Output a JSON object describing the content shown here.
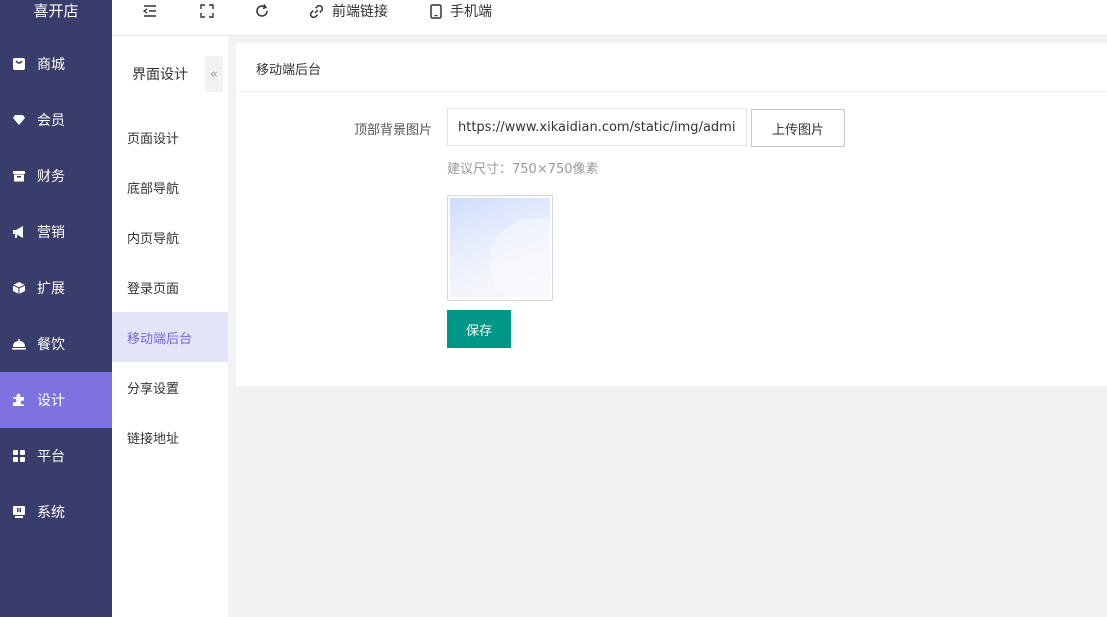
{
  "app": {
    "brand": "喜开店"
  },
  "sidebar": {
    "items": [
      {
        "label": "商城",
        "icon": "store-icon"
      },
      {
        "label": "会员",
        "icon": "diamond-icon"
      },
      {
        "label": "财务",
        "icon": "wallet-icon"
      },
      {
        "label": "营销",
        "icon": "megaphone-icon"
      },
      {
        "label": "扩展",
        "icon": "cube-icon"
      },
      {
        "label": "餐饮",
        "icon": "dish-icon"
      },
      {
        "label": "设计",
        "icon": "puzzle-icon",
        "active": true
      },
      {
        "label": "平台",
        "icon": "grid-icon"
      },
      {
        "label": "系统",
        "icon": "monitor-icon"
      }
    ],
    "active_color": "#7d72e0",
    "bg_color": "#393d6b"
  },
  "topbar": {
    "frontend_link": "前端链接",
    "mobile": "手机端"
  },
  "subnav": {
    "title": "界面设计",
    "collapse_glyph": "«",
    "items": [
      {
        "label": "页面设计"
      },
      {
        "label": "底部导航"
      },
      {
        "label": "内页导航"
      },
      {
        "label": "登录页面"
      },
      {
        "label": "移动端后台",
        "active": true
      },
      {
        "label": "分享设置"
      },
      {
        "label": "链接地址"
      }
    ]
  },
  "main": {
    "panel_title": "移动端后台",
    "form": {
      "bg_image_label": "顶部背景图片",
      "bg_image_value": "https://www.xikaidian.com/static/img/admin/head.png",
      "upload_label": "上传图片",
      "hint": "建议尺寸：750×750像素",
      "save_label": "保存"
    },
    "save_color": "#009688"
  }
}
